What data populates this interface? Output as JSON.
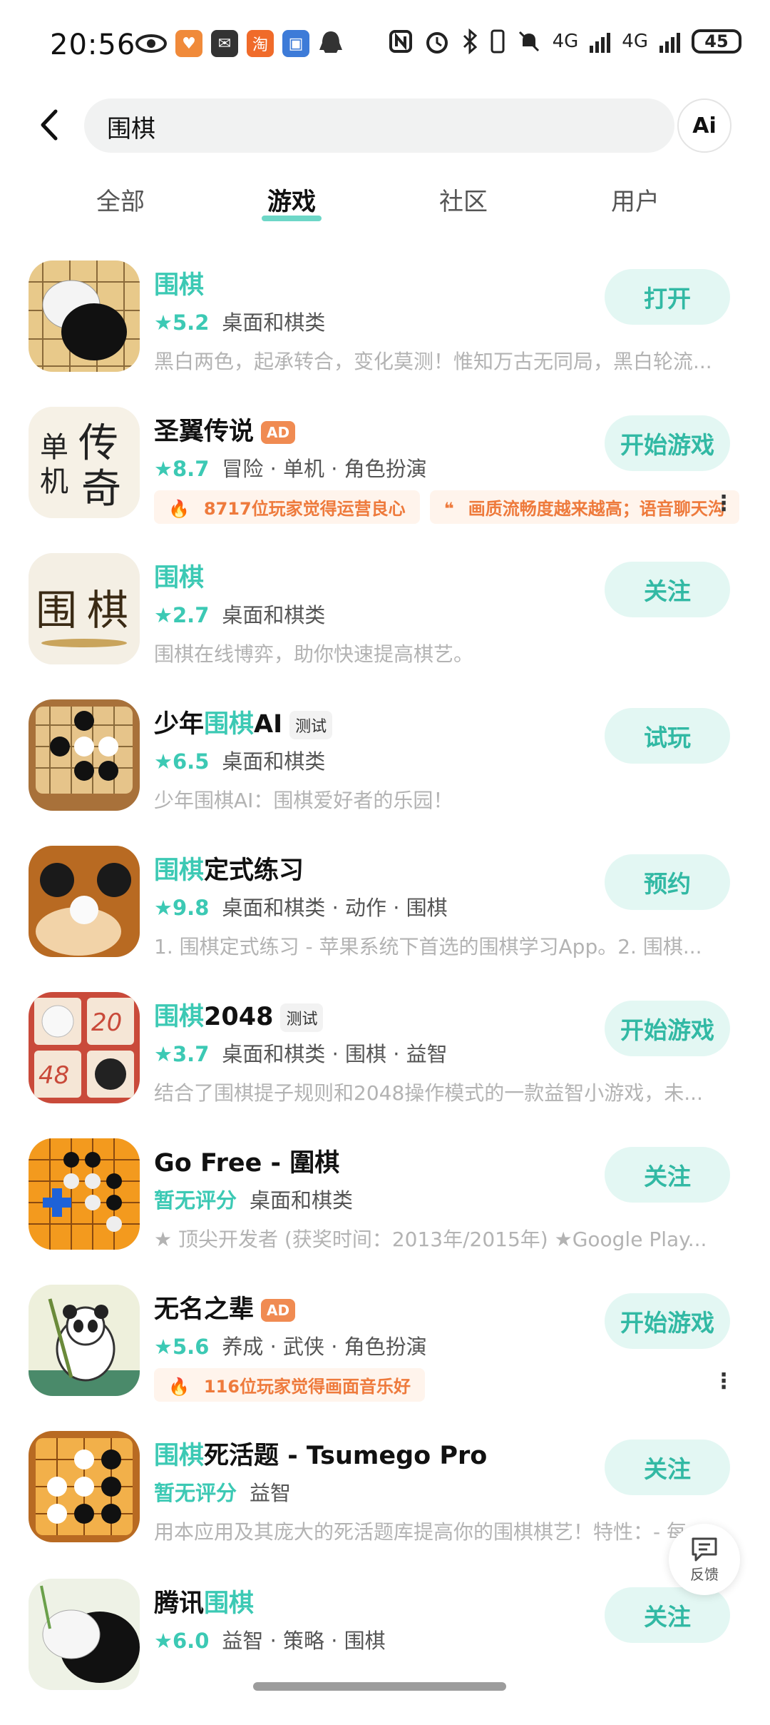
{
  "status_bar": {
    "time": "20:56",
    "battery": "45",
    "signal_label_1": "4G",
    "signal_label_2": "4G"
  },
  "search": {
    "query": "围棋",
    "ai_label": "Ai"
  },
  "tabs": [
    {
      "label": "全部"
    },
    {
      "label": "游戏"
    },
    {
      "label": "社区"
    },
    {
      "label": "用户"
    }
  ],
  "apps": [
    {
      "name_hl": "围棋",
      "name_rest": "",
      "tag": "",
      "score": "★5.2",
      "category": "桌面和棋类",
      "desc": "黑白两色，起承转合，变化莫测！惟知万古无同局，黑白轮流...",
      "button": "打开",
      "hot": []
    },
    {
      "name_hl": "",
      "name_rest": "圣翼传说",
      "tag": "AD",
      "score": "★8.7",
      "category": "冒险 · 单机 · 角色扮演",
      "desc": "",
      "button": "开始游戏",
      "hot": [
        "8717位玩家觉得运营良心",
        "画质流畅度越来越高；语音聊天沟"
      ]
    },
    {
      "name_hl": "围棋",
      "name_rest": "",
      "tag": "",
      "score": "★2.7",
      "category": "桌面和棋类",
      "desc": "围棋在线博弈，助你快速提高棋艺。",
      "button": "关注",
      "hot": []
    },
    {
      "name_pre": "少年",
      "name_hl": "围棋",
      "name_rest": "AI",
      "tag": "测试",
      "score": "★6.5",
      "category": "桌面和棋类",
      "desc": "少年围棋AI：围棋爱好者的乐园！",
      "button": "试玩",
      "hot": []
    },
    {
      "name_hl": "围棋",
      "name_rest": "定式练习",
      "tag": "",
      "score": "★9.8",
      "category": "桌面和棋类 · 动作 · 围棋",
      "desc": "1. 围棋定式练习 - 苹果系统下首选的围棋学习App。2. 围棋...",
      "button": "预约",
      "hot": []
    },
    {
      "name_hl": "围棋",
      "name_rest": "2048",
      "tag": "测试",
      "score": "★3.7",
      "category": "桌面和棋类 · 围棋 · 益智",
      "desc": "结合了围棋提子规则和2048操作模式的一款益智小游戏，未...",
      "button": "开始游戏",
      "hot": []
    },
    {
      "name_hl": "",
      "name_rest": "Go Free - 圍棋",
      "tag": "",
      "score": "暂无评分",
      "category": "桌面和棋类",
      "desc": "★ 顶尖开发者 (获奖时间：2013年/2015年) ★Google Play...",
      "button": "关注",
      "hot": []
    },
    {
      "name_hl": "",
      "name_rest": "无名之辈",
      "tag": "AD",
      "score": "★5.6",
      "category": "养成 · 武侠 · 角色扮演",
      "desc": "",
      "button": "开始游戏",
      "hot": [
        "116位玩家觉得画面音乐好"
      ]
    },
    {
      "name_hl": "围棋",
      "name_rest": "死活题 - Tsumego Pro",
      "tag": "",
      "score": "暂无评分",
      "category": "益智",
      "desc": "用本应用及其庞大的死活题库提高你的围棋棋艺！特性：- 每...",
      "button": "关注",
      "hot": []
    },
    {
      "name_pre": "腾讯",
      "name_hl": "围棋",
      "name_rest": "",
      "tag": "",
      "score": "★6.0",
      "category": "益智 · 策略 · 围棋",
      "desc": "",
      "button": "关注",
      "hot": []
    }
  ],
  "feedback_label": "反馈",
  "colors": {
    "accent": "#3cc9b4",
    "button_bg": "#e3f7f3",
    "ad_tag": "#f08b52",
    "hot_text": "#ee7a3c"
  }
}
